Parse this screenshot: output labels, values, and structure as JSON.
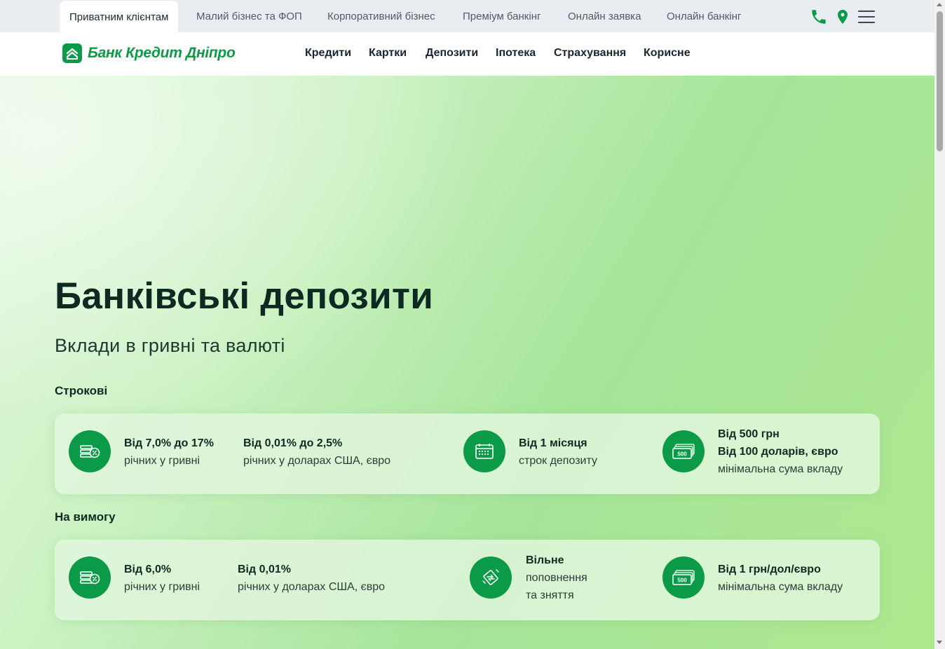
{
  "segments": [
    {
      "label": "Приватним клієнтам",
      "active": true
    },
    {
      "label": "Малий бізнес та ФОП",
      "active": false
    },
    {
      "label": "Корпоративний бізнес",
      "active": false
    },
    {
      "label": "Преміум банкінг",
      "active": false
    },
    {
      "label": "Онлайн заявка",
      "active": false
    },
    {
      "label": "Онлайн банкінг",
      "active": false
    }
  ],
  "header": {
    "logo_text": "Банк Кредит Дніпро",
    "nav": [
      "Кредити",
      "Картки",
      "Депозити",
      "Іпотека",
      "Страхування",
      "Корисне"
    ]
  },
  "hero": {
    "title": "Банківські депозити",
    "subtitle": "Вклади в гривні та валюті"
  },
  "term": {
    "label": "Строкові",
    "f1_bold": "Від 7,0% до 17%",
    "f1_text": "річних у гривні",
    "f2_bold": "Від 0,01% до 2,5%",
    "f2_text": "річних у доларах США, євро",
    "f3_bold": "Від 1 місяця",
    "f3_text": "строк депозиту",
    "f4_bold1": "Від 500 грн",
    "f4_bold2": "Від 100 доларів, євро",
    "f4_text": "мінімальна сума вкладу"
  },
  "demand": {
    "label": "На вимогу",
    "f1_bold": "Від 6,0%",
    "f1_text": "річних у гривні",
    "f2_bold": "Від 0,01%",
    "f2_text": "річних у доларах США, євро",
    "f3_bold": "Вільне",
    "f3_text1": "поповнення",
    "f3_text2": "та зняття",
    "f4_bold": "Від 1 грн/дол/євро",
    "f4_text": "мінімальна сума вкладу"
  },
  "icons": {
    "phone": "phone-icon",
    "location": "location-pin-icon",
    "menu": "hamburger-menu-icon",
    "percent_money": "money-percent-icon",
    "calendar": "calendar-icon",
    "banknote": "banknote-500-icon",
    "transfer": "transfer-arrows-icon"
  },
  "banknote_denomination": "500",
  "colors": {
    "brand_green": "#0b9a47",
    "topbar_bg": "#e9edf1",
    "title_text": "#0c2a22"
  }
}
